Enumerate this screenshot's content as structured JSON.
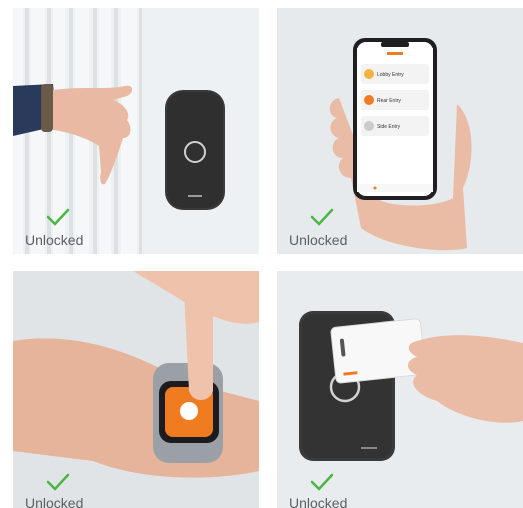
{
  "tiles": [
    {
      "status": "Unlocked",
      "icon": "checkmark-icon"
    },
    {
      "status": "Unlocked",
      "icon": "checkmark-icon"
    },
    {
      "status": "Unlocked",
      "icon": "checkmark-icon"
    },
    {
      "status": "Unlocked",
      "icon": "checkmark-icon"
    }
  ],
  "phone": {
    "doors": [
      {
        "label": "Lobby Entry"
      },
      {
        "label": "Rear Entry"
      },
      {
        "label": "Side Entry"
      }
    ]
  },
  "colors": {
    "check": "#4bb543",
    "accent": "#f07c22",
    "reader": "#3a3a3a"
  }
}
